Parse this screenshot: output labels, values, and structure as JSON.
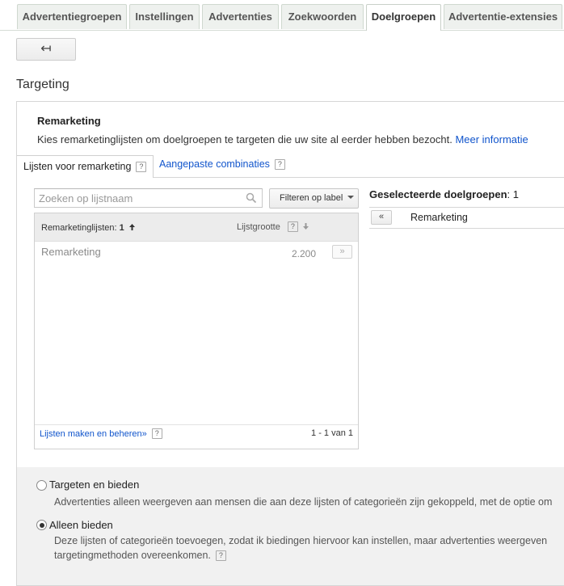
{
  "tabs": [
    "Advertentiegroepen",
    "Instellingen",
    "Advertenties",
    "Zoekwoorden",
    "Doelgroepen",
    "Advertentie-extensies"
  ],
  "back_button_label": "↤",
  "page_title": "Targeting",
  "remarketing": {
    "title": "Remarketing",
    "description": "Kies remarketinglijsten om doelgroepen te targeten die uw site al eerder hebben bezocht.",
    "more_info_link": "Meer informatie"
  },
  "subtabs": {
    "tab1": "Lijsten voor remarketing",
    "tab2": "Aangepaste combinaties",
    "help": "?"
  },
  "search": {
    "placeholder": "Zoeken op lijstnaam"
  },
  "filter_button": "Filteren op label",
  "list": {
    "col1_label": "Remarketinglijsten:",
    "col1_count": "1",
    "col2_label": "Lijstgrootte",
    "rows": [
      {
        "name": "Remarketing",
        "size": "2.200",
        "add": "»"
      }
    ],
    "footer_link": "Lijsten maken en beheren»",
    "footer_count": "1 - 1 van 1"
  },
  "selected": {
    "title_bold": "Geselecteerde doelgroepen",
    "title_count": ": 1",
    "remove": "«",
    "item": "Remarketing"
  },
  "options": {
    "opt1_label": "Targeten en bieden",
    "opt1_desc": "Advertenties alleen weergeven aan mensen die aan deze lijsten of categorieën zijn gekoppeld, met de optie om",
    "opt2_label": "Alleen bieden",
    "opt2_desc_line1": "Deze lijsten of categorieën toevoegen, zodat ik biedingen hiervoor kan instellen, maar advertenties weergeven",
    "opt2_desc_line2": "targetingmethoden overeenkomen.",
    "selected": "opt2"
  },
  "colors": {
    "link": "#1155cc",
    "tab_bg": "#eef1ee"
  }
}
